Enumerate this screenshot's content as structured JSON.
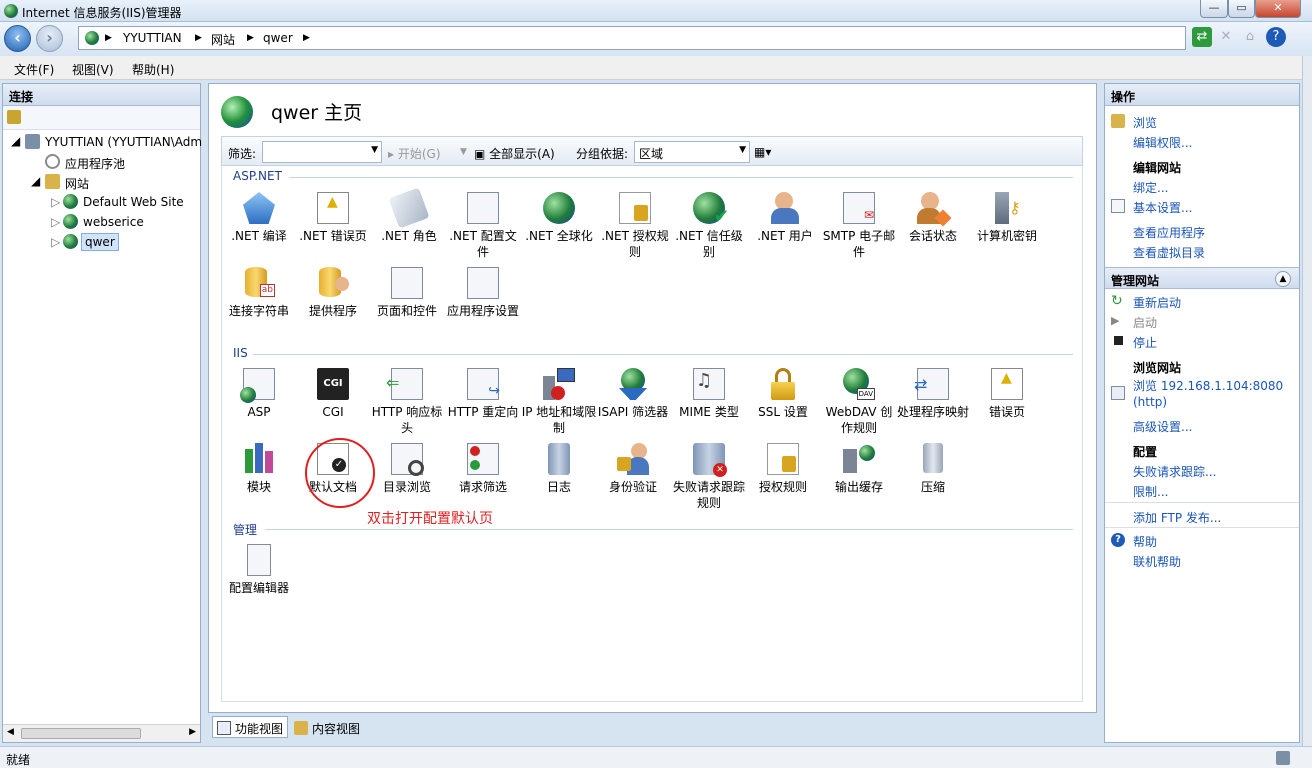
{
  "window": {
    "title": "Internet 信息服务(IIS)管理器"
  },
  "address": {
    "segments": [
      "YYUTTIAN",
      "网站",
      "qwer"
    ]
  },
  "menu": [
    "文件(F)",
    "视图(V)",
    "帮助(H)"
  ],
  "left_panel": {
    "header": "连接",
    "tree": {
      "root": "YYUTTIAN (YYUTTIAN\\Adm",
      "app_pool": "应用程序池",
      "sites": "网站",
      "site1": "Default Web Site",
      "site2": "webserice",
      "site3": "qwer"
    }
  },
  "center": {
    "title": "qwer 主页",
    "filter_label": "筛选:",
    "start_label": "开始(G)",
    "show_all_label": "全部显示(A)",
    "group_by_label": "分组依据:",
    "group_by_value": "区域",
    "groups": {
      "aspnet": "ASP.NET",
      "iis": "IIS",
      "mgmt": "管理"
    },
    "aspnet_features": [
      ".NET 编译",
      ".NET 错误页",
      ".NET 角色",
      ".NET 配置文件",
      ".NET 全球化",
      ".NET 授权规则",
      ".NET 信任级别",
      ".NET 用户",
      "SMTP 电子邮件",
      "会话状态",
      "计算机密钥",
      "连接字符串",
      "提供程序",
      "页面和控件",
      "应用程序设置"
    ],
    "iis_features": [
      "ASP",
      "CGI",
      "HTTP 响应标头",
      "HTTP 重定向",
      "IP 地址和域限制",
      "ISAPI 筛选器",
      "MIME 类型",
      "SSL 设置",
      "WebDAV 创作规则",
      "处理程序映射",
      "错误页",
      "模块",
      "默认文档",
      "目录浏览",
      "请求筛选",
      "日志",
      "身份验证",
      "失败请求跟踪规则",
      "授权规则",
      "输出缓存",
      "压缩"
    ],
    "mgmt_features": [
      "配置编辑器"
    ],
    "annotation": "双击打开配置默认页",
    "annotation_color": "#e02020"
  },
  "view_tabs": {
    "features": "功能视图",
    "content": "内容视图"
  },
  "right_panel": {
    "header": "操作",
    "browse": "浏览",
    "edit_perms": "编辑权限...",
    "edit_site_header": "编辑网站",
    "bindings": "绑定...",
    "basic_settings": "基本设置...",
    "view_apps": "查看应用程序",
    "view_vdirs": "查看虚拟目录",
    "manage_site_header": "管理网站",
    "restart": "重新启动",
    "start": "启动",
    "stop": "停止",
    "browse_site_header": "浏览网站",
    "browse_addr": "浏览 192.168.1.104:8080",
    "browse_proto": "(http)",
    "advanced": "高级设置...",
    "config_header": "配置",
    "failed_req": "失败请求跟踪...",
    "limits": "限制...",
    "add_ftp": "添加 FTP 发布...",
    "help": "帮助",
    "online_help": "联机帮助"
  },
  "status": {
    "text": "就绪"
  }
}
